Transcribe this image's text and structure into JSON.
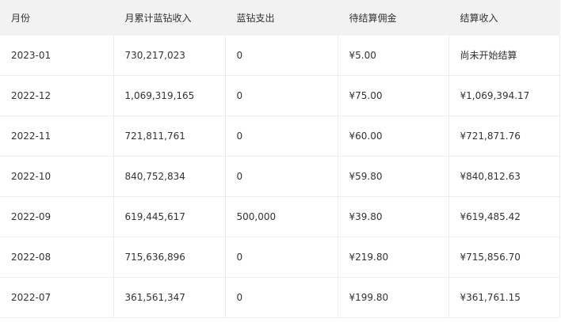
{
  "table": {
    "headers": [
      "月份",
      "月累计蓝钻收入",
      "蓝钻支出",
      "待结算佣金",
      "结算收入"
    ],
    "rows": [
      [
        "2023-01",
        "730,217,023",
        "0",
        "¥5.00",
        "尚未开始结算"
      ],
      [
        "2022-12",
        "1,069,319,165",
        "0",
        "¥75.00",
        "¥1,069,394.17"
      ],
      [
        "2022-11",
        "721,811,761",
        "0",
        "¥60.00",
        "¥721,871.76"
      ],
      [
        "2022-10",
        "840,752,834",
        "0",
        "¥59.80",
        "¥840,812.63"
      ],
      [
        "2022-09",
        "619,445,617",
        "500,000",
        "¥39.80",
        "¥619,485.42"
      ],
      [
        "2022-08",
        "715,636,896",
        "0",
        "¥219.80",
        "¥715,856.70"
      ],
      [
        "2022-07",
        "361,561,347",
        "0",
        "¥199.80",
        "¥361,761.15"
      ]
    ]
  },
  "colors": {
    "header_bg": "#f2f2f2",
    "border": "#ececec",
    "text": "#333333"
  }
}
